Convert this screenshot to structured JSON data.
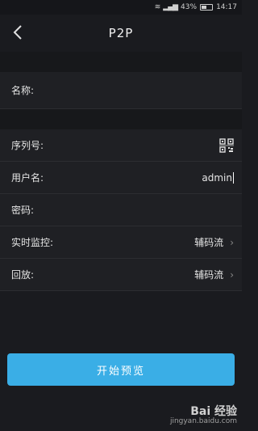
{
  "status": {
    "battery": "43%",
    "time": "14:17"
  },
  "nav": {
    "title": "P2P",
    "back_icon": "chevron-left-icon"
  },
  "form": {
    "name_label": "名称:",
    "serial_label": "序列号:",
    "serial_icon": "qr-scan-icon",
    "username_label": "用户名:",
    "username_value": "admin",
    "password_label": "密码:",
    "live_label": "实时监控:",
    "live_value": "辅码流",
    "playback_label": "回放:",
    "playback_value": "辅码流"
  },
  "actions": {
    "start_preview": "开始预览"
  },
  "watermark": {
    "logo": "Bai 经验",
    "url": "jingyan.baidu.com"
  },
  "colors": {
    "accent": "#3aaee6",
    "background": "#1a1b1f",
    "row": "#1f2024"
  }
}
